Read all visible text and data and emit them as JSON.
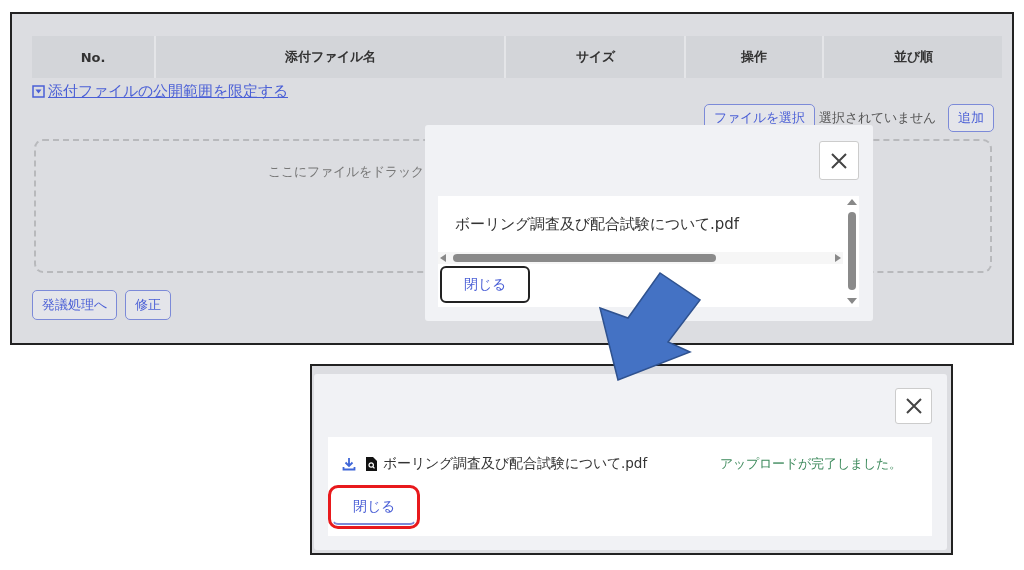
{
  "top_screen": {
    "table": {
      "columns": [
        "No.",
        "添付ファイル名",
        "サイズ",
        "操作",
        "並び順"
      ]
    },
    "visibility_link": "添付ファイルの公開範囲を限定する",
    "file_select_button": "ファイルを選択",
    "file_status": "選択されていません",
    "add_button": "追加",
    "dropzone_text": "ここにファイルをドラック",
    "buttons": [
      "発議処理へ",
      "修正"
    ],
    "dialog": {
      "file_name": "ボーリング調査及び配合試験について.pdf",
      "close_button": "閉じる"
    }
  },
  "bottom_screen": {
    "dialog": {
      "file_name": "ボーリング調査及び配合試験について.pdf",
      "status": "アップロードが完了しました。",
      "close_button": "閉じる",
      "highlighted": true
    }
  }
}
